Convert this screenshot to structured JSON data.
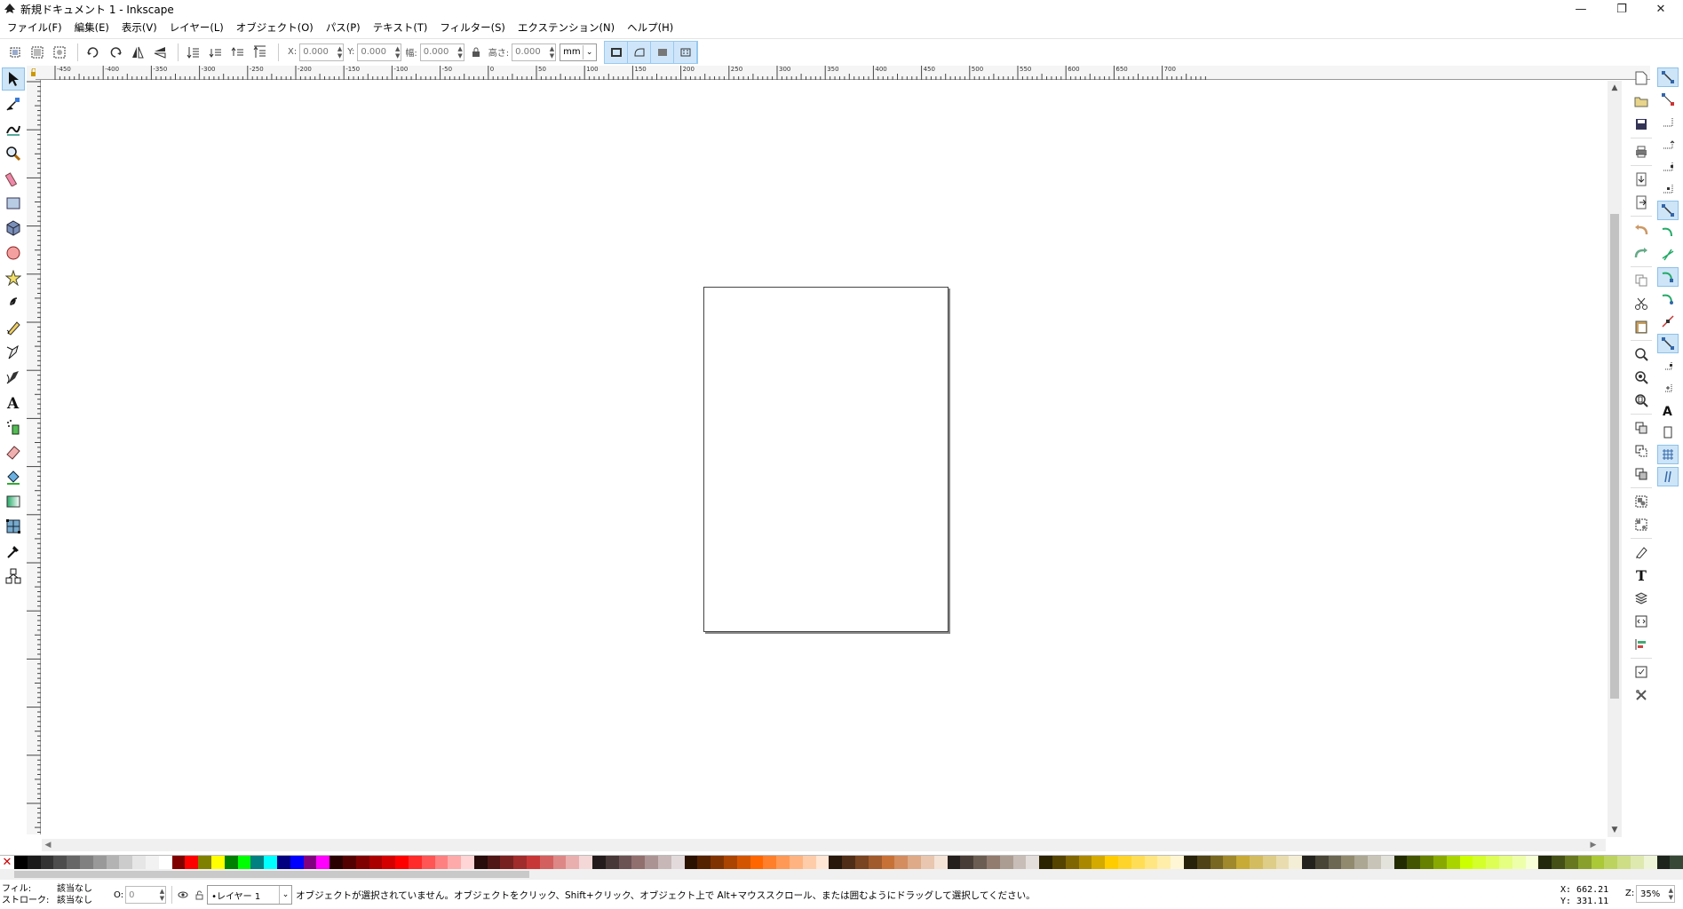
{
  "window": {
    "title": "新規ドキュメント 1 - Inkscape",
    "minimize": "—",
    "maximize": "❐",
    "close": "✕"
  },
  "menu": [
    "ファイル(F)",
    "編集(E)",
    "表示(V)",
    "レイヤー(L)",
    "オブジェクト(O)",
    "パス(P)",
    "テキスト(T)",
    "フィルター(S)",
    "エクステンション(N)",
    "ヘルプ(H)"
  ],
  "toolcontrols": {
    "x_label": "X:",
    "x_value": "0.000",
    "y_label": "Y:",
    "y_value": "0.000",
    "w_label": "幅:",
    "w_value": "0.000",
    "h_label": "高さ:",
    "h_value": "0.000",
    "unit": "mm"
  },
  "ruler": {
    "labels": [
      "-450",
      "-400",
      "-350",
      "-300",
      "-250",
      "-200",
      "-150",
      "-100",
      "-50",
      "0",
      "50",
      "100",
      "150",
      "200",
      "250",
      "300",
      "350",
      "400",
      "450",
      "500",
      "550",
      "600",
      "650",
      "700"
    ]
  },
  "palette": {
    "colors": [
      "#000000",
      "#1a1a1a",
      "#333333",
      "#4d4d4d",
      "#666666",
      "#808080",
      "#999999",
      "#b3b3b3",
      "#cccccc",
      "#e6e6e6",
      "#f2f2f2",
      "#ffffff",
      "#800000",
      "#ff0000",
      "#808000",
      "#ffff00",
      "#008000",
      "#00ff00",
      "#008080",
      "#00ffff",
      "#000080",
      "#0000ff",
      "#800080",
      "#ff00ff",
      "#2b0000",
      "#550000",
      "#800000",
      "#aa0000",
      "#d40000",
      "#ff0000",
      "#ff2a2a",
      "#ff5555",
      "#ff8080",
      "#ffaaaa",
      "#ffd5d5",
      "#280b0b",
      "#501616",
      "#782121",
      "#a02c2c",
      "#c83737",
      "#d35f5f",
      "#de8787",
      "#e9afaf",
      "#f4d7d7",
      "#241c1c",
      "#483737",
      "#6c5353",
      "#916f6f",
      "#ac9393",
      "#c8b7b7",
      "#e3dbdb",
      "#2b1100",
      "#552200",
      "#803300",
      "#aa4400",
      "#d45500",
      "#ff6600",
      "#ff7f2a",
      "#ff9955",
      "#ffb380",
      "#ffccaa",
      "#ffe6d5",
      "#28170b",
      "#502d16",
      "#784421",
      "#a05a2c",
      "#c87137",
      "#d38d5f",
      "#deaa87",
      "#e9c6af",
      "#f4e3d7",
      "#241f1c",
      "#483e37",
      "#6c5d53",
      "#917c6f",
      "#ac9d93",
      "#c8beb7",
      "#e3dedb",
      "#2b2200",
      "#554400",
      "#806600",
      "#aa8800",
      "#d4aa00",
      "#ffcc00",
      "#ffd42a",
      "#ffdd55",
      "#ffe680",
      "#ffeeaa",
      "#fff6d5",
      "#28220b",
      "#504416",
      "#786721",
      "#a0892c",
      "#c8ab37",
      "#d3bc5f",
      "#decd87",
      "#e9ddaf",
      "#f4eed7",
      "#24221c",
      "#484537",
      "#6c6753",
      "#918a6f",
      "#aca793",
      "#c8c4b7",
      "#e3e2db",
      "#222b00",
      "#445500",
      "#668000",
      "#88aa00",
      "#aad400",
      "#ccff00",
      "#d4ff2a",
      "#ddff55",
      "#e5ff80",
      "#eeffaa",
      "#f6ffd5",
      "#22280b",
      "#445016",
      "#677821",
      "#89a02c",
      "#abc837",
      "#bcd35f",
      "#cdde87",
      "#dde9af",
      "#eef4d7",
      "#1c241c",
      "#374837"
    ]
  },
  "status": {
    "fill_label": "フィル:",
    "stroke_label": "ストローク:",
    "fill_value": "該当なし",
    "stroke_value": "該当なし",
    "opacity_label": "O:",
    "opacity_value": "0",
    "layer": "•レイヤー 1",
    "message": "オブジェクトが選択されていません。オブジェクトをクリック、Shift+クリック、オブジェクト上で Alt+マウススクロール、または囲むようにドラッグして選択してください。",
    "x_coord": "X:  662.21",
    "y_coord": "Y:  331.11",
    "zoom_label": "Z:",
    "zoom_value": "35%"
  }
}
